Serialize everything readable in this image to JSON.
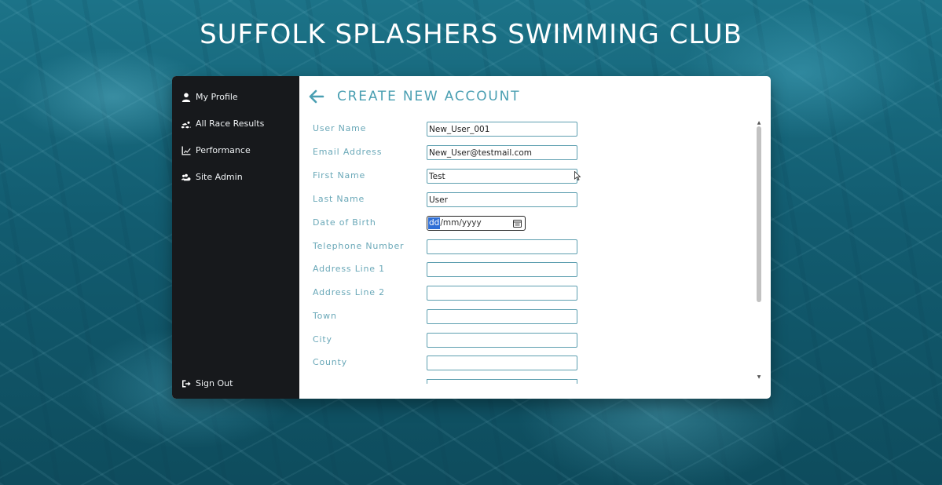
{
  "site": {
    "title": "SUFFOLK SPLASHERS SWIMMING CLUB"
  },
  "sidebar": {
    "items": [
      {
        "label": "My Profile",
        "icon": "user-icon"
      },
      {
        "label": "All Race Results",
        "icon": "swimmer-icon"
      },
      {
        "label": "Performance",
        "icon": "chart-line-icon"
      },
      {
        "label": "Site Admin",
        "icon": "users-cog-icon"
      }
    ],
    "sign_out": {
      "label": "Sign Out",
      "icon": "sign-out-icon"
    }
  },
  "page": {
    "title": "CREATE NEW ACCOUNT",
    "back_icon": "arrow-left-icon"
  },
  "form": {
    "user_name": {
      "label": "User Name",
      "value": "New_User_001"
    },
    "email": {
      "label": "Email Address",
      "value": "New_User@testmail.com"
    },
    "first_name": {
      "label": "First Name",
      "value": "Test"
    },
    "last_name": {
      "label": "Last Name",
      "value": "User"
    },
    "dob": {
      "label": "Date of Birth",
      "segment_selected": "dd",
      "segment_rest": "/mm/yyyy"
    },
    "telephone": {
      "label": "Telephone Number",
      "value": ""
    },
    "address1": {
      "label": "Address Line 1",
      "value": ""
    },
    "address2": {
      "label": "Address Line 2",
      "value": ""
    },
    "town": {
      "label": "Town",
      "value": ""
    },
    "city": {
      "label": "City",
      "value": ""
    },
    "county": {
      "label": "County",
      "value": ""
    }
  },
  "colors": {
    "accent": "#4a9fb2",
    "label": "#6aa8b8",
    "sidebar_bg": "#17191c",
    "selection": "#2f6fd6"
  }
}
